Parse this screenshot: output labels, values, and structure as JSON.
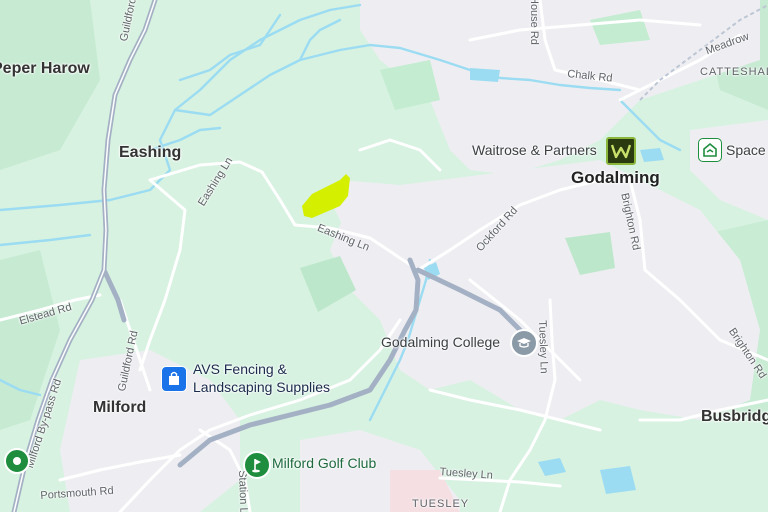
{
  "places": {
    "eashing": "Eashing",
    "milford": "Milford",
    "godalming": "Godalming",
    "busbridge": "Busbridge",
    "peper_harow": "Peper Harow",
    "catteshall": "CATTESHALL",
    "tuesley": "TUESLEY"
  },
  "roads": {
    "guildford_godalming": "Guildford and Godalming",
    "eashing_ln_west": "Eashing Ln",
    "eashing_ln_east": "Eashing Ln",
    "elstead_rd": "Elstead Rd",
    "milford_bypass": "Milford By-pass Rd",
    "guildford_rd": "Guildford Rd",
    "ockford_rd": "Ockford Rd",
    "tuesley_ln_vertical": "Tuesley Ln",
    "tuesley_ln": "Tuesley Ln",
    "brighton_rd": "Brighton Rd",
    "brighton_rd_south": "Brighton Rd",
    "chalk_rd": "Chalk Rd",
    "meadrow": "Meadrow",
    "portsmouth_rd": "Portsmouth Rd",
    "station_ln": "Station Ln",
    "house_rd": "House Rd"
  },
  "pois": {
    "waitrose": "Waitrose & Partners",
    "space": "Space",
    "godalming_college": "Godalming College",
    "avs_line1": "AVS Fencing &",
    "avs_line2": "Landscaping Supplies",
    "milford_golf": "Milford Golf Club"
  },
  "colors": {
    "land": "#d7f2e1",
    "urban": "#eeeef2",
    "park": "#c3ecd1",
    "water": "#9bdcf2",
    "major_road": "#a4b1c4",
    "highlight": "#d4f000",
    "poi_blue": "#1a73e8",
    "poi_green": "#1e8e3e",
    "waitrose_green": "#5a7e14"
  },
  "icons": {
    "waitrose": "waitrose-w-icon",
    "space": "storage-icon",
    "college": "graduation-cap-icon",
    "avs": "shopping-bag-icon",
    "golf": "golf-icon",
    "marker": "location-marker-icon"
  }
}
